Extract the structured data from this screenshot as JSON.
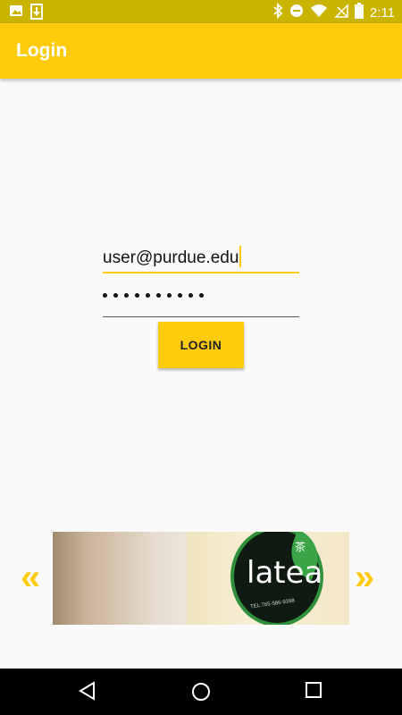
{
  "status_bar": {
    "time": "2:11",
    "icons": [
      "image-icon",
      "download-icon",
      "bluetooth-icon",
      "do-not-disturb-icon",
      "wifi-icon",
      "no-sim-icon",
      "battery-icon"
    ]
  },
  "app_bar": {
    "title": "Login"
  },
  "form": {
    "email_value": "user@purdue.edu",
    "password_mask_length": 10,
    "login_label": "LOGIN"
  },
  "banner": {
    "prev_label": "«",
    "next_label": "»",
    "logo_word": "latea",
    "logo_glyph": "茶",
    "logo_phone": "TEL:765-586-9398"
  },
  "colors": {
    "accent": "#ffcc0d",
    "status_bar": "#c9b400",
    "background": "#fafafa"
  },
  "nav_bar": {
    "icons": [
      "back-icon",
      "home-icon",
      "recents-icon"
    ]
  }
}
